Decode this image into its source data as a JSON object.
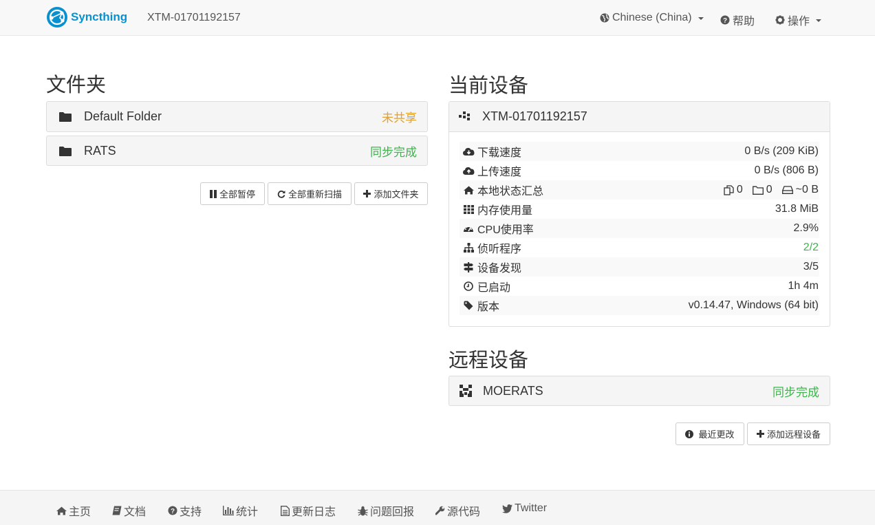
{
  "navbar": {
    "brand": "Syncthing",
    "device_name": "XTM-01701192157",
    "language": "Chinese (China)",
    "help": "帮助",
    "actions": "操作"
  },
  "folders": {
    "title": "文件夹",
    "items": [
      {
        "label": "Default Folder",
        "status": "未共享",
        "status_color": "#e0a030"
      },
      {
        "label": "RATS",
        "status": "同步完成",
        "status_color": "#3cb54a"
      }
    ],
    "buttons": {
      "pause_all": "全部暂停",
      "rescan_all": "全部重新扫描",
      "add_folder": "添加文件夹"
    }
  },
  "this_device": {
    "title": "当前设备",
    "name": "XTM-01701192157",
    "rows": [
      {
        "icon": "cloud-download-icon",
        "label": "下载速度",
        "value": "0 B/s (209 KiB)"
      },
      {
        "icon": "cloud-upload-icon",
        "label": "上传速度",
        "value": "0 B/s (806 B)"
      },
      {
        "icon": "home-icon",
        "label": "本地状态汇总",
        "files": "0",
        "dirs": "0",
        "size": "~0 B"
      },
      {
        "icon": "grid-icon",
        "label": "内存使用量",
        "value": "31.8 MiB"
      },
      {
        "icon": "dashboard-icon",
        "label": "CPU使用率",
        "value": "2.9%"
      },
      {
        "icon": "sitemap-icon",
        "label": "侦听程序",
        "value": "2/2",
        "value_color": "#3cb54a"
      },
      {
        "icon": "signpost-icon",
        "label": "设备发现",
        "value": "3/5"
      },
      {
        "icon": "clock-icon",
        "label": "已启动",
        "value": "1h 4m"
      },
      {
        "icon": "tag-icon",
        "label": "版本",
        "value": "v0.14.47, Windows (64 bit)"
      }
    ]
  },
  "remote_devices": {
    "title": "远程设备",
    "items": [
      {
        "label": "MOERATS",
        "status": "同步完成",
        "status_color": "#3cb54a"
      }
    ],
    "buttons": {
      "recent_changes": "最近更改",
      "add_remote": "添加远程设备"
    }
  },
  "footer": {
    "home": "主页",
    "docs": "文档",
    "support": "支持",
    "stats": "统计",
    "changelog": "更新日志",
    "bugs": "问题回报",
    "source": "源代码",
    "twitter": "Twitter"
  }
}
